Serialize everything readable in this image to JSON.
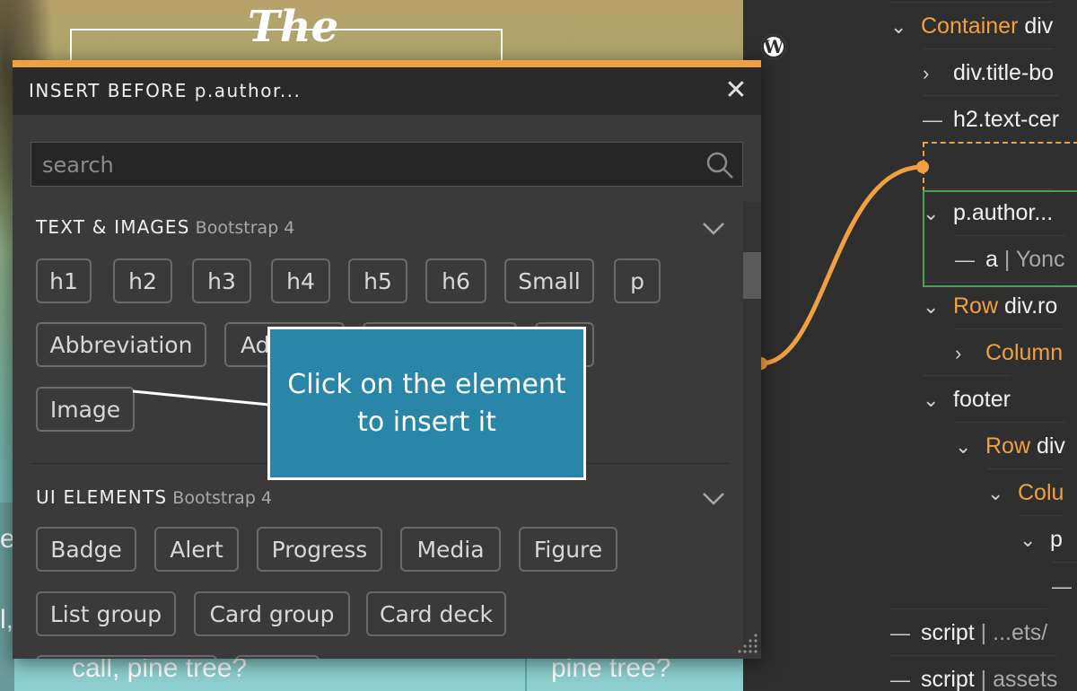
{
  "preview": {
    "heading_word": "The",
    "text_left": "call, pine tree?",
    "text_right": "pine tree?",
    "text_edge_1": "e",
    "text_edge_2": "l,"
  },
  "wp_icon": "wordpress-icon",
  "tree": {
    "nodes": [
      {
        "toggle": "⌄",
        "label": "Container",
        "label_color": "orange",
        "rest": " div"
      },
      {
        "toggle": "›",
        "label": "div.title-bo",
        "rest": ""
      },
      {
        "toggle": "—",
        "label": "h2.text-cer",
        "rest": ""
      },
      {
        "toggle": "⌄",
        "label": "p.author...",
        "rest": ""
      },
      {
        "toggle": "—",
        "label": "a",
        "rest": " | Yonc"
      },
      {
        "toggle": "⌄",
        "label": "Row",
        "label_color": "orange",
        "rest": " div.ro"
      },
      {
        "toggle": "›",
        "label": "Column",
        "label_color": "orange",
        "rest": ""
      },
      {
        "toggle": "⌄",
        "label": "footer",
        "rest": ""
      },
      {
        "toggle": "⌄",
        "label": "Row",
        "label_color": "orange",
        "rest": " div"
      },
      {
        "toggle": "⌄",
        "label": "Colu",
        "label_color": "orange",
        "rest": ""
      },
      {
        "toggle": "⌄",
        "label": "p",
        "rest": ""
      },
      {
        "toggle": "—",
        "label": "",
        "rest": ""
      },
      {
        "toggle": "—",
        "label": "script",
        "rest": " | ...ets/"
      },
      {
        "toggle": "—",
        "label": "script",
        "rest": " | assets"
      }
    ]
  },
  "modal": {
    "title": "INSERT BEFORE p.author...",
    "close_icon": "close-icon",
    "search_placeholder": "search",
    "search_icon": "search-icon",
    "sections": [
      {
        "title": "TEXT & IMAGES",
        "sub": "Bootstrap 4",
        "items": [
          "h1",
          "h2",
          "h3",
          "h4",
          "h5",
          "h6",
          "Small",
          "p",
          "Abbreviation",
          "Ad",
          "",
          "",
          "Image"
        ]
      },
      {
        "title": "UI ELEMENTS",
        "sub": "Bootstrap 4",
        "items": [
          "Badge",
          "Alert",
          "Progress",
          "Media",
          "Figure",
          "List group",
          "Card group",
          "Card deck",
          "",
          ""
        ]
      }
    ]
  },
  "tooltip": {
    "text": "Click on the element to insert it"
  },
  "colors": {
    "accent": "#f0a040",
    "tooltip_bg": "#2a86a8",
    "selected": "#49a24f"
  }
}
